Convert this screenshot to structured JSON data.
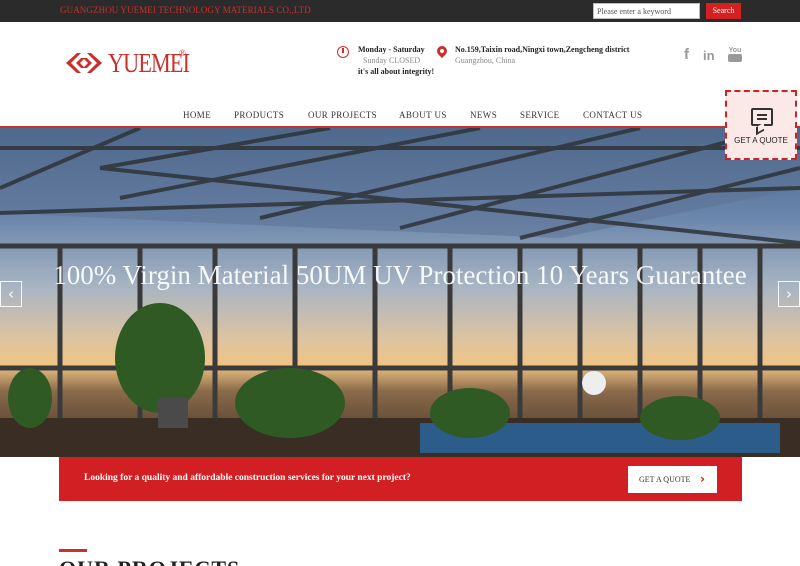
{
  "topbar": {
    "company": "GUANGZHOU YUEMEI TECHNOLOGY MATERIALS CO.,LTD",
    "search_placeholder": "Please enter a keyword",
    "search_button": "Search"
  },
  "header": {
    "logo_text": "YUEMEI",
    "logo_registered": "®",
    "hours_days": "Monday - Saturday",
    "hours_closed": "Sunday CLOSED",
    "motto": "it's all about integrity!",
    "address_line1": "No.159,Taixin road,Ningxi town,Zengcheng district",
    "address_line2": "Guangzhou, China",
    "social": {
      "facebook": "f",
      "linkedin": "in",
      "youtube": "You"
    }
  },
  "nav": {
    "items": [
      "HOME",
      "PRODUCTS",
      "OUR PROJECTS",
      "ABOUT US",
      "NEWS",
      "SERVICE",
      "CONTACT US"
    ]
  },
  "hero": {
    "headline": "100% Virgin Material  50UM UV Protection 10 Years Guarantee",
    "prev_arrow": "‹",
    "next_arrow": "›"
  },
  "quote_tab": {
    "label": "GET A QUOTE"
  },
  "cta": {
    "text": "Looking for a quality and affordable construction services for your next project?",
    "button": "GET A QUOTE",
    "button_chevron": "›"
  },
  "section": {
    "title": "OUR PROJECTS"
  },
  "colors": {
    "brand_red": "#c9302c",
    "cta_red": "#d11f23",
    "topbar": "#2b2b2b"
  }
}
